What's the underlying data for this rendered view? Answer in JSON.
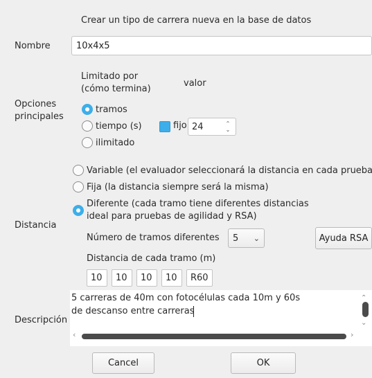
{
  "header": {
    "title": "Crear un tipo de carrera nueva en la base de datos"
  },
  "nombre": {
    "label": "Nombre",
    "value": "10x4x5"
  },
  "opciones": {
    "label_line1": "Opciones",
    "label_line2": "principales",
    "limitado_line1": "Limitado por",
    "limitado_line2": "(cómo termina)",
    "valor_label": "valor",
    "radio_tramos": "tramos",
    "radio_tiempo": "tiempo (s)",
    "radio_ilimitado": "ilimitado",
    "fijo_label": "fijo",
    "fijo_checked": true,
    "spin_value": "24",
    "selected": "tramos"
  },
  "distancia": {
    "label": "Distancia",
    "radio_variable": "Variable (el evaluador seleccionará la distancia en cada prueba)",
    "radio_fija": "Fija (la distancia siempre será la misma)",
    "radio_diferente_line1": "Diferente (cada tramo tiene diferentes distancias",
    "radio_diferente_line2": "ideal para pruebas de agilidad y RSA)",
    "selected": "diferente",
    "num_tramos_label": "Número de tramos diferentes",
    "num_tramos_value": "5",
    "ayuda_button": "Ayuda RSA",
    "distancia_tramo_label": "Distancia de cada tramo  (m)",
    "tramos": [
      "10",
      "10",
      "10",
      "10",
      "R60"
    ]
  },
  "descripcion": {
    "label": "Descripción",
    "line1": "5 carreras de 40m con fotocélulas cada 10m y 60s",
    "line2": "de descanso entre carreras"
  },
  "footer": {
    "cancel_label": "Cancel",
    "ok_label": "OK"
  },
  "colors": {
    "accent": "#3daee9",
    "background": "#efefef"
  }
}
